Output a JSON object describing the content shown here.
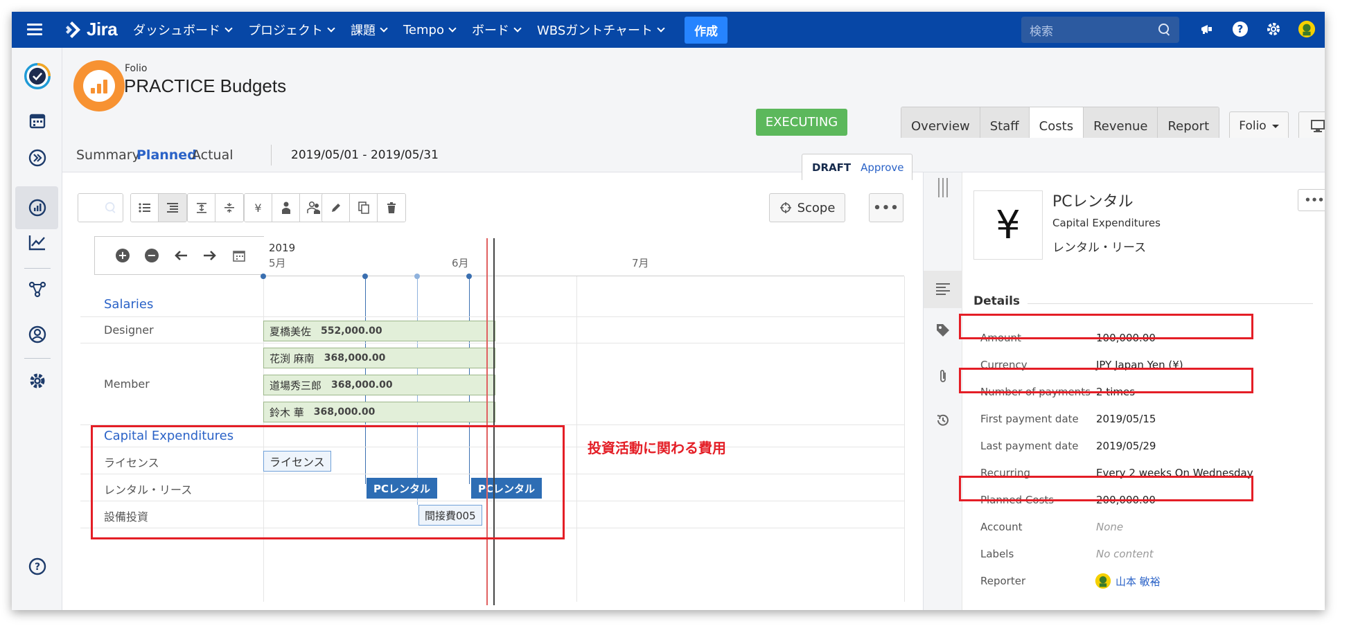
{
  "topnav": {
    "logo": "Jira",
    "items": [
      {
        "label": "ダッシュボード"
      },
      {
        "label": "プロジェクト"
      },
      {
        "label": "課題"
      },
      {
        "label": "Tempo"
      },
      {
        "label": "ボード"
      },
      {
        "label": "WBSガントチャート"
      }
    ],
    "create_label": "作成",
    "search_placeholder": "検索"
  },
  "project": {
    "key_label": "Folio",
    "name": "PRACTICE Budgets",
    "status": "EXECUTING",
    "status_color": "#5cb85c",
    "tabs": [
      "Overview",
      "Staff",
      "Costs",
      "Revenue",
      "Report"
    ],
    "active_tab": "Costs",
    "folio_menu": "Folio"
  },
  "subtabs": {
    "items": [
      "Summary",
      "Planned",
      "Actual"
    ],
    "active": "Planned",
    "date_start": "2019/05/01",
    "date_sep": "-",
    "date_end": "2019/05/31",
    "draft": "DRAFT",
    "approve": "Approve"
  },
  "toolbar": {
    "scope_label": "Scope",
    "more_label": "•••"
  },
  "timeline": {
    "year": "2019",
    "months": [
      "5月",
      "6月",
      "7月"
    ]
  },
  "gantt": {
    "groups": [
      {
        "name": "Salaries"
      },
      {
        "name": "Capital Expenditures"
      }
    ],
    "rows": {
      "designer": "Designer",
      "member": "Member",
      "license": "ライセンス",
      "rental": "レンタル・リース",
      "capex": "設備投資"
    },
    "bars": [
      {
        "person": "夏橋美佐",
        "amount": "552,000.00"
      },
      {
        "person": "花渕 麻南",
        "amount": "368,000.00"
      },
      {
        "person": "道場秀三郎",
        "amount": "368,000.00"
      },
      {
        "person": "鈴木 華",
        "amount": "368,000.00"
      }
    ],
    "license_tag": "ライセンス",
    "pc_tag": "PCレンタル",
    "indirect_tag": "間接費005"
  },
  "annotation": "投資活動に関わる費用",
  "annotation_color": "#e41e26",
  "detail": {
    "icon_symbol": "¥",
    "title": "PCレンタル",
    "category": "Capital Expenditures",
    "subcategory": "レンタル・リース",
    "section": "Details",
    "fields": [
      {
        "key": "Amount",
        "value": "100,000.00"
      },
      {
        "key": "Currency",
        "value": "JPY Japan Yen (¥)"
      },
      {
        "key": "Number of payments",
        "value": "2 times"
      },
      {
        "key": "First payment date",
        "value": "2019/05/15"
      },
      {
        "key": "Last payment date",
        "value": "2019/05/29"
      },
      {
        "key": "Recurring",
        "value": "Every 2 weeks On Wednesday"
      },
      {
        "key": "Planned Costs",
        "value": "200,000.00"
      },
      {
        "key": "Account",
        "value": "None"
      },
      {
        "key": "Labels",
        "value": "No content"
      },
      {
        "key": "Reporter",
        "value": "山本 敏裕"
      }
    ]
  },
  "colors": {
    "nav_bg": "#0747a6",
    "accent": "#2a62c7",
    "bar_green": "#e2efd9",
    "tag_blue": "#2d6db4"
  }
}
